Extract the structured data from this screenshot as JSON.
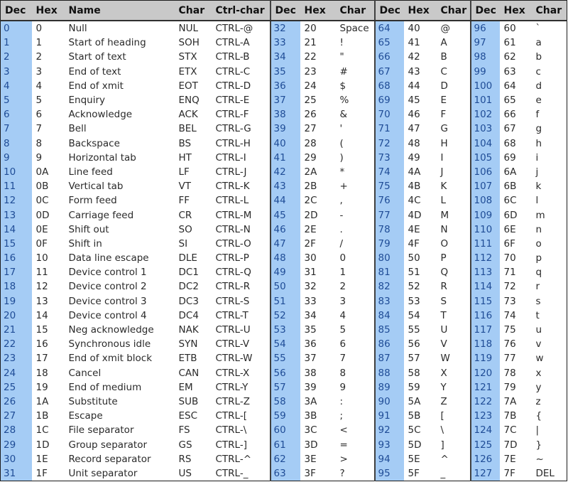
{
  "headers": {
    "group1": [
      "Dec",
      "Hex",
      "Name",
      "Char",
      "Ctrl-char"
    ],
    "group2": [
      "Dec",
      "Hex",
      "Char"
    ],
    "group3": [
      "Dec",
      "Hex",
      "Char"
    ],
    "group4": [
      "Dec",
      "Hex",
      "Char"
    ]
  },
  "colors": {
    "header_bg": "#c9c9c9",
    "dec_column_bg": "#a5ccf5",
    "dec_text": "#1f4c96",
    "border": "#303030"
  },
  "control_chars": [
    {
      "dec": "0",
      "hex": "0",
      "name": "Null",
      "char": "NUL",
      "ctrl": "CTRL-@"
    },
    {
      "dec": "1",
      "hex": "1",
      "name": "Start of heading",
      "char": "SOH",
      "ctrl": "CTRL-A"
    },
    {
      "dec": "2",
      "hex": "2",
      "name": "Start of text",
      "char": "STX",
      "ctrl": "CTRL-B"
    },
    {
      "dec": "3",
      "hex": "3",
      "name": "End of text",
      "char": "ETX",
      "ctrl": "CTRL-C"
    },
    {
      "dec": "4",
      "hex": "4",
      "name": "End of xmit",
      "char": "EOT",
      "ctrl": "CTRL-D"
    },
    {
      "dec": "5",
      "hex": "5",
      "name": "Enquiry",
      "char": "ENQ",
      "ctrl": "CTRL-E"
    },
    {
      "dec": "6",
      "hex": "6",
      "name": "Acknowledge",
      "char": "ACK",
      "ctrl": "CTRL-F"
    },
    {
      "dec": "7",
      "hex": "7",
      "name": "Bell",
      "char": "BEL",
      "ctrl": "CTRL-G"
    },
    {
      "dec": "8",
      "hex": "8",
      "name": "Backspace",
      "char": "BS",
      "ctrl": "CTRL-H"
    },
    {
      "dec": "9",
      "hex": "9",
      "name": "Horizontal tab",
      "char": "HT",
      "ctrl": "CTRL-I"
    },
    {
      "dec": "10",
      "hex": "0A",
      "name": "Line feed",
      "char": "LF",
      "ctrl": "CTRL-J"
    },
    {
      "dec": "11",
      "hex": "0B",
      "name": "Vertical tab",
      "char": "VT",
      "ctrl": "CTRL-K"
    },
    {
      "dec": "12",
      "hex": "0C",
      "name": "Form feed",
      "char": "FF",
      "ctrl": "CTRL-L"
    },
    {
      "dec": "13",
      "hex": "0D",
      "name": "Carriage feed",
      "char": "CR",
      "ctrl": "CTRL-M"
    },
    {
      "dec": "14",
      "hex": "0E",
      "name": "Shift out",
      "char": "SO",
      "ctrl": "CTRL-N"
    },
    {
      "dec": "15",
      "hex": "0F",
      "name": "Shift in",
      "char": "SI",
      "ctrl": "CTRL-O"
    },
    {
      "dec": "16",
      "hex": "10",
      "name": "Data line escape",
      "char": "DLE",
      "ctrl": "CTRL-P"
    },
    {
      "dec": "17",
      "hex": "11",
      "name": "Device control 1",
      "char": "DC1",
      "ctrl": "CTRL-Q"
    },
    {
      "dec": "18",
      "hex": "12",
      "name": "Device control 2",
      "char": "DC2",
      "ctrl": "CTRL-R"
    },
    {
      "dec": "19",
      "hex": "13",
      "name": "Device control 3",
      "char": "DC3",
      "ctrl": "CTRL-S"
    },
    {
      "dec": "20",
      "hex": "14",
      "name": "Device control 4",
      "char": "DC4",
      "ctrl": "CTRL-T"
    },
    {
      "dec": "21",
      "hex": "15",
      "name": "Neg acknowledge",
      "char": "NAK",
      "ctrl": "CTRL-U"
    },
    {
      "dec": "22",
      "hex": "16",
      "name": "Synchronous idle",
      "char": "SYN",
      "ctrl": "CTRL-V"
    },
    {
      "dec": "23",
      "hex": "17",
      "name": "End of xmit block",
      "char": "ETB",
      "ctrl": "CTRL-W"
    },
    {
      "dec": "24",
      "hex": "18",
      "name": "Cancel",
      "char": "CAN",
      "ctrl": "CTRL-X"
    },
    {
      "dec": "25",
      "hex": "19",
      "name": "End of medium",
      "char": "EM",
      "ctrl": "CTRL-Y"
    },
    {
      "dec": "26",
      "hex": "1A",
      "name": "Substitute",
      "char": "SUB",
      "ctrl": "CTRL-Z"
    },
    {
      "dec": "27",
      "hex": "1B",
      "name": "Escape",
      "char": "ESC",
      "ctrl": "CTRL-["
    },
    {
      "dec": "28",
      "hex": "1C",
      "name": "File separator",
      "char": "FS",
      "ctrl": "CTRL-\\"
    },
    {
      "dec": "29",
      "hex": "1D",
      "name": "Group separator",
      "char": "GS",
      "ctrl": "CTRL-]"
    },
    {
      "dec": "30",
      "hex": "1E",
      "name": "Record separator",
      "char": "RS",
      "ctrl": "CTRL-^"
    },
    {
      "dec": "31",
      "hex": "1F",
      "name": "Unit separator",
      "char": "US",
      "ctrl": "CTRL-_"
    }
  ],
  "group2": [
    {
      "dec": "32",
      "hex": "20",
      "char": "Space"
    },
    {
      "dec": "33",
      "hex": "21",
      "char": "!"
    },
    {
      "dec": "34",
      "hex": "22",
      "char": "\""
    },
    {
      "dec": "35",
      "hex": "23",
      "char": "#"
    },
    {
      "dec": "36",
      "hex": "24",
      "char": "$"
    },
    {
      "dec": "37",
      "hex": "25",
      "char": "%"
    },
    {
      "dec": "38",
      "hex": "26",
      "char": "&"
    },
    {
      "dec": "39",
      "hex": "27",
      "char": "'"
    },
    {
      "dec": "40",
      "hex": "28",
      "char": "("
    },
    {
      "dec": "41",
      "hex": "29",
      "char": ")"
    },
    {
      "dec": "42",
      "hex": "2A",
      "char": "*"
    },
    {
      "dec": "43",
      "hex": "2B",
      "char": "+"
    },
    {
      "dec": "44",
      "hex": "2C",
      "char": ","
    },
    {
      "dec": "45",
      "hex": "2D",
      "char": "-"
    },
    {
      "dec": "46",
      "hex": "2E",
      "char": "."
    },
    {
      "dec": "47",
      "hex": "2F",
      "char": "/"
    },
    {
      "dec": "48",
      "hex": "30",
      "char": "0"
    },
    {
      "dec": "49",
      "hex": "31",
      "char": "1"
    },
    {
      "dec": "50",
      "hex": "32",
      "char": "2"
    },
    {
      "dec": "51",
      "hex": "33",
      "char": "3"
    },
    {
      "dec": "52",
      "hex": "34",
      "char": "4"
    },
    {
      "dec": "53",
      "hex": "35",
      "char": "5"
    },
    {
      "dec": "54",
      "hex": "36",
      "char": "6"
    },
    {
      "dec": "55",
      "hex": "37",
      "char": "7"
    },
    {
      "dec": "56",
      "hex": "38",
      "char": "8"
    },
    {
      "dec": "57",
      "hex": "39",
      "char": "9"
    },
    {
      "dec": "58",
      "hex": "3A",
      "char": ":"
    },
    {
      "dec": "59",
      "hex": "3B",
      "char": ";"
    },
    {
      "dec": "60",
      "hex": "3C",
      "char": "<"
    },
    {
      "dec": "61",
      "hex": "3D",
      "char": "="
    },
    {
      "dec": "62",
      "hex": "3E",
      "char": ">"
    },
    {
      "dec": "63",
      "hex": "3F",
      "char": "?"
    }
  ],
  "group3": [
    {
      "dec": "64",
      "hex": "40",
      "char": "@"
    },
    {
      "dec": "65",
      "hex": "41",
      "char": "A"
    },
    {
      "dec": "66",
      "hex": "42",
      "char": "B"
    },
    {
      "dec": "67",
      "hex": "43",
      "char": "C"
    },
    {
      "dec": "68",
      "hex": "44",
      "char": "D"
    },
    {
      "dec": "69",
      "hex": "45",
      "char": "E"
    },
    {
      "dec": "70",
      "hex": "46",
      "char": "F"
    },
    {
      "dec": "71",
      "hex": "47",
      "char": "G"
    },
    {
      "dec": "72",
      "hex": "48",
      "char": "H"
    },
    {
      "dec": "73",
      "hex": "49",
      "char": "I"
    },
    {
      "dec": "74",
      "hex": "4A",
      "char": "J"
    },
    {
      "dec": "75",
      "hex": "4B",
      "char": "K"
    },
    {
      "dec": "76",
      "hex": "4C",
      "char": "L"
    },
    {
      "dec": "77",
      "hex": "4D",
      "char": "M"
    },
    {
      "dec": "78",
      "hex": "4E",
      "char": "N"
    },
    {
      "dec": "79",
      "hex": "4F",
      "char": "O"
    },
    {
      "dec": "80",
      "hex": "50",
      "char": "P"
    },
    {
      "dec": "81",
      "hex": "51",
      "char": "Q"
    },
    {
      "dec": "82",
      "hex": "52",
      "char": "R"
    },
    {
      "dec": "83",
      "hex": "53",
      "char": "S"
    },
    {
      "dec": "84",
      "hex": "54",
      "char": "T"
    },
    {
      "dec": "85",
      "hex": "55",
      "char": "U"
    },
    {
      "dec": "86",
      "hex": "56",
      "char": "V"
    },
    {
      "dec": "87",
      "hex": "57",
      "char": "W"
    },
    {
      "dec": "88",
      "hex": "58",
      "char": "X"
    },
    {
      "dec": "89",
      "hex": "59",
      "char": "Y"
    },
    {
      "dec": "90",
      "hex": "5A",
      "char": "Z"
    },
    {
      "dec": "91",
      "hex": "5B",
      "char": "["
    },
    {
      "dec": "92",
      "hex": "5C",
      "char": "\\"
    },
    {
      "dec": "93",
      "hex": "5D",
      "char": "]"
    },
    {
      "dec": "94",
      "hex": "5E",
      "char": "^"
    },
    {
      "dec": "95",
      "hex": "5F",
      "char": "_"
    }
  ],
  "group4": [
    {
      "dec": "96",
      "hex": "60",
      "char": "`"
    },
    {
      "dec": "97",
      "hex": "61",
      "char": "a"
    },
    {
      "dec": "98",
      "hex": "62",
      "char": "b"
    },
    {
      "dec": "99",
      "hex": "63",
      "char": "c"
    },
    {
      "dec": "100",
      "hex": "64",
      "char": "d"
    },
    {
      "dec": "101",
      "hex": "65",
      "char": "e"
    },
    {
      "dec": "102",
      "hex": "66",
      "char": "f"
    },
    {
      "dec": "103",
      "hex": "67",
      "char": "g"
    },
    {
      "dec": "104",
      "hex": "68",
      "char": "h"
    },
    {
      "dec": "105",
      "hex": "69",
      "char": "i"
    },
    {
      "dec": "106",
      "hex": "6A",
      "char": "j"
    },
    {
      "dec": "107",
      "hex": "6B",
      "char": "k"
    },
    {
      "dec": "108",
      "hex": "6C",
      "char": "l"
    },
    {
      "dec": "109",
      "hex": "6D",
      "char": "m"
    },
    {
      "dec": "110",
      "hex": "6E",
      "char": "n"
    },
    {
      "dec": "111",
      "hex": "6F",
      "char": "o"
    },
    {
      "dec": "112",
      "hex": "70",
      "char": "p"
    },
    {
      "dec": "113",
      "hex": "71",
      "char": "q"
    },
    {
      "dec": "114",
      "hex": "72",
      "char": "r"
    },
    {
      "dec": "115",
      "hex": "73",
      "char": "s"
    },
    {
      "dec": "116",
      "hex": "74",
      "char": "t"
    },
    {
      "dec": "117",
      "hex": "75",
      "char": "u"
    },
    {
      "dec": "118",
      "hex": "76",
      "char": "v"
    },
    {
      "dec": "119",
      "hex": "77",
      "char": "w"
    },
    {
      "dec": "120",
      "hex": "78",
      "char": "x"
    },
    {
      "dec": "121",
      "hex": "79",
      "char": "y"
    },
    {
      "dec": "122",
      "hex": "7A",
      "char": "z"
    },
    {
      "dec": "123",
      "hex": "7B",
      "char": "{"
    },
    {
      "dec": "124",
      "hex": "7C",
      "char": "|"
    },
    {
      "dec": "125",
      "hex": "7D",
      "char": "}"
    },
    {
      "dec": "126",
      "hex": "7E",
      "char": "~"
    },
    {
      "dec": "127",
      "hex": "7F",
      "char": "DEL"
    }
  ]
}
